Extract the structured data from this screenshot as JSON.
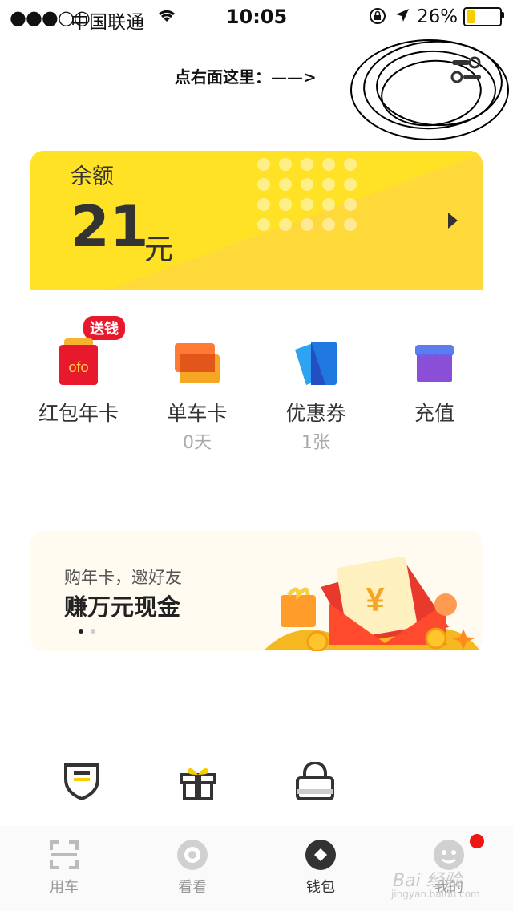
{
  "status_bar": {
    "signal": "●●●○○",
    "carrier": "中国联通",
    "time": "10:05",
    "battery_percent": "26%",
    "battery_level": 0.26
  },
  "header": {
    "hint": "点右面这里：——>",
    "settings_icon": "filter-settings-icon"
  },
  "balance_card": {
    "label": "余额",
    "amount": "21",
    "unit": "元",
    "accent_color": "#ffe226"
  },
  "quick_actions": [
    {
      "label": "红包年卡",
      "sub": "",
      "badge": "送钱",
      "icon": "red-envelope-icon"
    },
    {
      "label": "单车卡",
      "sub": "0天",
      "icon": "bike-card-icon"
    },
    {
      "label": "优惠券",
      "sub": "1张",
      "icon": "coupon-icon"
    },
    {
      "label": "充值",
      "sub": "",
      "icon": "shop-icon"
    }
  ],
  "banner": {
    "subtitle": "购年卡，邀好友",
    "title": "赚万元现金",
    "pages": 2,
    "active_page": 1
  },
  "bottom_icons": [
    "shield-icon",
    "gift-icon",
    "bag-lock-icon"
  ],
  "tabs": [
    {
      "label": "用车",
      "icon": "scan-icon",
      "active": false
    },
    {
      "label": "看看",
      "icon": "eye-icon",
      "active": false
    },
    {
      "label": "钱包",
      "icon": "wallet-icon",
      "active": true
    },
    {
      "label": "我的",
      "icon": "profile-icon",
      "active": false
    }
  ],
  "watermark": {
    "text": "Bai 经验",
    "url": "jingyan.baidu.com"
  }
}
